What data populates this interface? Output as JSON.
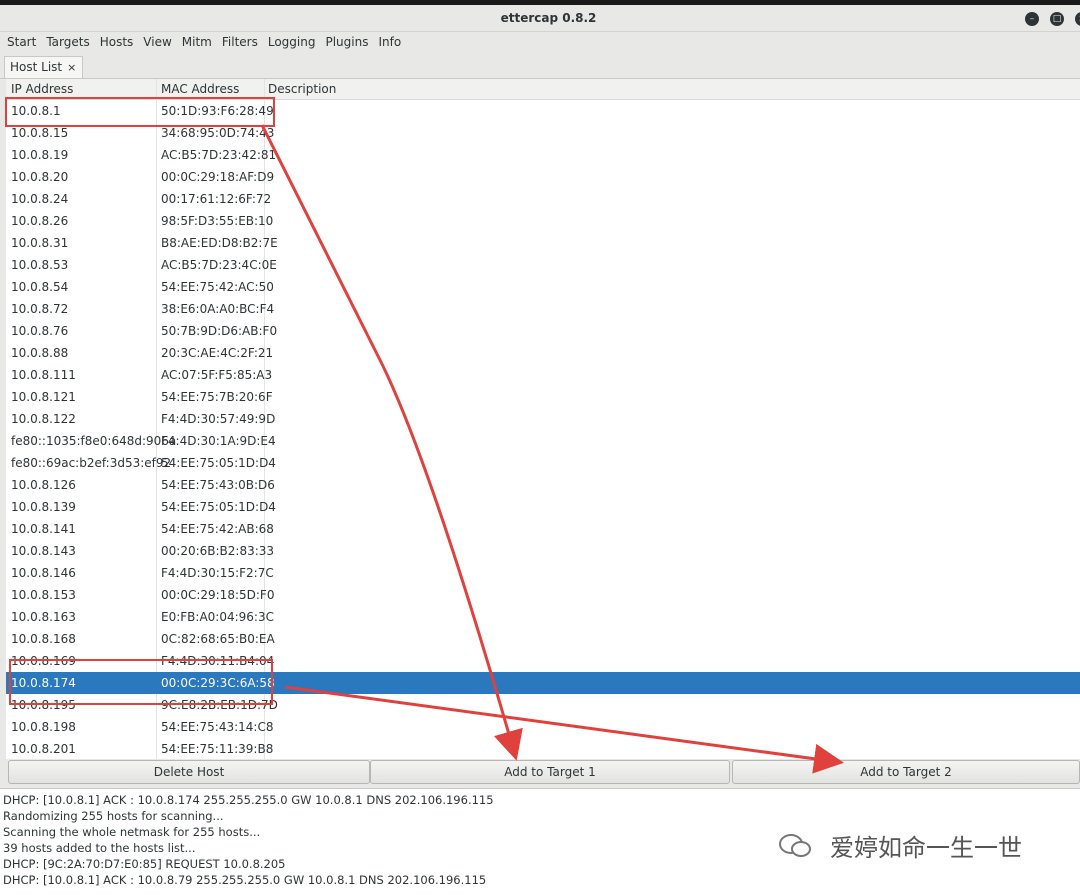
{
  "window": {
    "title": "ettercap 0.8.2"
  },
  "menu": [
    "Start",
    "Targets",
    "Hosts",
    "View",
    "Mitm",
    "Filters",
    "Logging",
    "Plugins",
    "Info"
  ],
  "tab": {
    "label": "Host List",
    "close": "×"
  },
  "columns": [
    "IP Address",
    "MAC Address",
    "Description"
  ],
  "hosts": [
    {
      "ip": "10.0.8.1",
      "mac": "50:1D:93:F6:28:49"
    },
    {
      "ip": "10.0.8.15",
      "mac": "34:68:95:0D:74:43"
    },
    {
      "ip": "10.0.8.19",
      "mac": "AC:B5:7D:23:42:81"
    },
    {
      "ip": "10.0.8.20",
      "mac": "00:0C:29:18:AF:D9"
    },
    {
      "ip": "10.0.8.24",
      "mac": "00:17:61:12:6F:72"
    },
    {
      "ip": "10.0.8.26",
      "mac": "98:5F:D3:55:EB:10"
    },
    {
      "ip": "10.0.8.31",
      "mac": "B8:AE:ED:D8:B2:7E"
    },
    {
      "ip": "10.0.8.53",
      "mac": "AC:B5:7D:23:4C:0E"
    },
    {
      "ip": "10.0.8.54",
      "mac": "54:EE:75:42:AC:50"
    },
    {
      "ip": "10.0.8.72",
      "mac": "38:E6:0A:A0:BC:F4"
    },
    {
      "ip": "10.0.8.76",
      "mac": "50:7B:9D:D6:AB:F0"
    },
    {
      "ip": "10.0.8.88",
      "mac": "20:3C:AE:4C:2F:21"
    },
    {
      "ip": "10.0.8.111",
      "mac": "AC:07:5F:F5:85:A3"
    },
    {
      "ip": "10.0.8.121",
      "mac": "54:EE:75:7B:20:6F"
    },
    {
      "ip": "10.0.8.122",
      "mac": "F4:4D:30:57:49:9D"
    },
    {
      "ip": "fe80::1035:f8e0:648d:906a",
      "mac": "F4:4D:30:1A:9D:E4"
    },
    {
      "ip": "fe80::69ac:b2ef:3d53:ef92",
      "mac": "54:EE:75:05:1D:D4"
    },
    {
      "ip": "10.0.8.126",
      "mac": "54:EE:75:43:0B:D6"
    },
    {
      "ip": "10.0.8.139",
      "mac": "54:EE:75:05:1D:D4"
    },
    {
      "ip": "10.0.8.141",
      "mac": "54:EE:75:42:AB:68"
    },
    {
      "ip": "10.0.8.143",
      "mac": "00:20:6B:B2:83:33"
    },
    {
      "ip": "10.0.8.146",
      "mac": "F4:4D:30:15:F2:7C"
    },
    {
      "ip": "10.0.8.153",
      "mac": "00:0C:29:18:5D:F0"
    },
    {
      "ip": "10.0.8.163",
      "mac": "E0:FB:A0:04:96:3C"
    },
    {
      "ip": "10.0.8.168",
      "mac": "0C:82:68:65:B0:EA"
    },
    {
      "ip": "10.0.8.169",
      "mac": "F4:4D:30:11:B4:04"
    },
    {
      "ip": "10.0.8.174",
      "mac": "00:0C:29:3C:6A:58"
    },
    {
      "ip": "10.0.8.195",
      "mac": "9C:E8:2B:EB:1D:7D"
    },
    {
      "ip": "10.0.8.198",
      "mac": "54:EE:75:43:14:C8"
    },
    {
      "ip": "10.0.8.201",
      "mac": "54:EE:75:11:39:B8"
    }
  ],
  "selected_index": 26,
  "buttons": {
    "delete": "Delete Host",
    "target1": "Add to Target 1",
    "target2": "Add to Target 2"
  },
  "log": [
    "DHCP: [10.0.8.1] ACK : 10.0.8.174 255.255.255.0 GW 10.0.8.1 DNS 202.106.196.115",
    "Randomizing 255 hosts for scanning...",
    "Scanning the whole netmask for 255 hosts...",
    "39 hosts added to the hosts list...",
    "DHCP: [9C:2A:70:D7:E0:85] REQUEST 10.0.8.205",
    "DHCP: [10.0.8.1] ACK : 10.0.8.79 255.255.255.0 GW 10.0.8.1 DNS 202.106.196.115"
  ],
  "watermark": "爱婷如命一生一世",
  "colors": {
    "selection": "#2a78bd",
    "annotation": "#e0413c"
  }
}
